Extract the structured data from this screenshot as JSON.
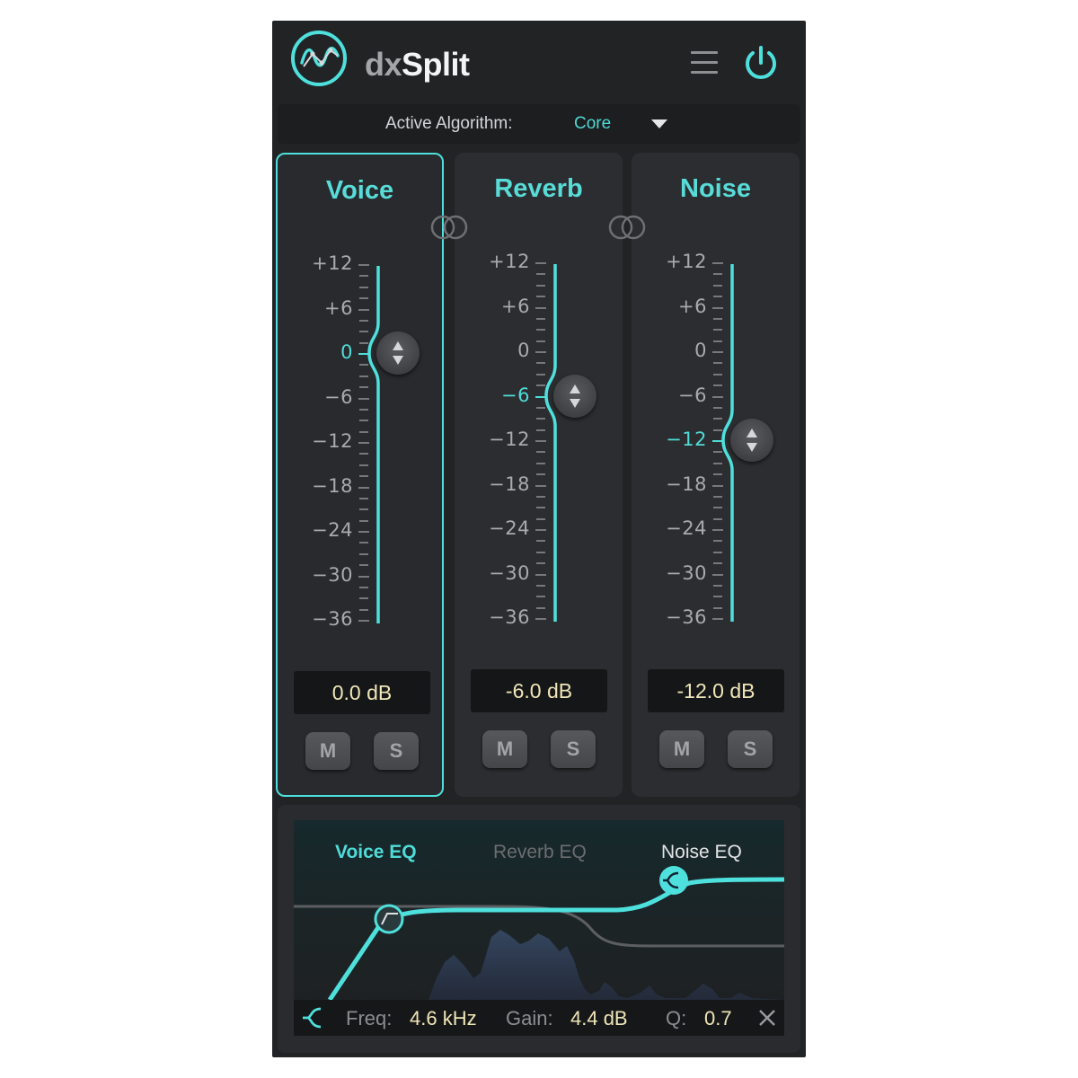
{
  "header": {
    "brand_prefix": "dx",
    "brand_name": "Split",
    "accent_color": "#4ee0dc"
  },
  "algorithm": {
    "label": "Active Algorithm:",
    "value": "Core"
  },
  "scale_labels": [
    "+12",
    "+6",
    "0",
    "−6",
    "−12",
    "−18",
    "−24",
    "−30",
    "−36"
  ],
  "strips": [
    {
      "title": "Voice",
      "gain_db": 0,
      "display": "0.0 dB",
      "active": true,
      "mute_label": "M",
      "solo_label": "S"
    },
    {
      "title": "Reverb",
      "gain_db": -6,
      "display": "-6.0 dB",
      "active": false,
      "mute_label": "M",
      "solo_label": "S"
    },
    {
      "title": "Noise",
      "gain_db": -12,
      "display": "-12.0 dB",
      "active": false,
      "mute_label": "M",
      "solo_label": "S"
    }
  ],
  "eq": {
    "tabs": [
      "Voice EQ",
      "Reverb EQ",
      "Noise EQ"
    ],
    "active_tab": "Voice EQ",
    "freq_label": "Freq:",
    "freq_value": "4.6 kHz",
    "gain_label": "Gain:",
    "gain_value": "4.4 dB",
    "q_label": "Q:",
    "q_value": "0.7"
  }
}
